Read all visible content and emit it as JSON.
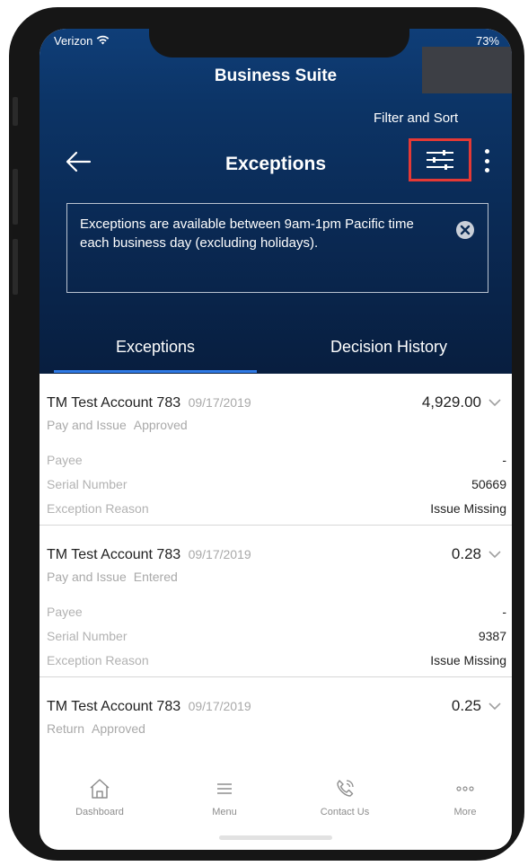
{
  "status_bar": {
    "carrier": "Verizon",
    "battery": "73%"
  },
  "header": {
    "app_title": "Business Suite",
    "filter_sort_label": "Filter and Sort",
    "page_title": "Exceptions"
  },
  "notice": {
    "text": "Exceptions are available between 9am-1pm Pacific time each business day (excluding holidays)."
  },
  "tabs": [
    {
      "label": "Exceptions",
      "active": true
    },
    {
      "label": "Decision History",
      "active": false
    }
  ],
  "exceptions": [
    {
      "account": "TM Test Account 783",
      "date": "09/17/2019",
      "amount": "4,929.00",
      "type": "Pay and Issue",
      "status": "Approved",
      "payee_label": "Payee",
      "payee_value": "-",
      "serial_label": "Serial Number",
      "serial_value": "50669",
      "reason_label": "Exception Reason",
      "reason_value": "Issue Missing"
    },
    {
      "account": "TM Test Account 783",
      "date": "09/17/2019",
      "amount": "0.28",
      "type": "Pay and Issue",
      "status": "Entered",
      "payee_label": "Payee",
      "payee_value": "-",
      "serial_label": "Serial Number",
      "serial_value": "9387",
      "reason_label": "Exception Reason",
      "reason_value": "Issue Missing"
    },
    {
      "account": "TM Test Account 783",
      "date": "09/17/2019",
      "amount": "0.25",
      "type": "Return",
      "status": "Approved"
    }
  ],
  "bottom_nav": [
    {
      "label": "Dashboard",
      "icon": "home-icon"
    },
    {
      "label": "Menu",
      "icon": "menu-icon"
    },
    {
      "label": "Contact Us",
      "icon": "phone-icon"
    },
    {
      "label": "More",
      "icon": "more-icon"
    }
  ],
  "colors": {
    "header_blue": "#0c3466",
    "tab_underline": "#2f7ae5",
    "highlight_border": "#e53935"
  }
}
